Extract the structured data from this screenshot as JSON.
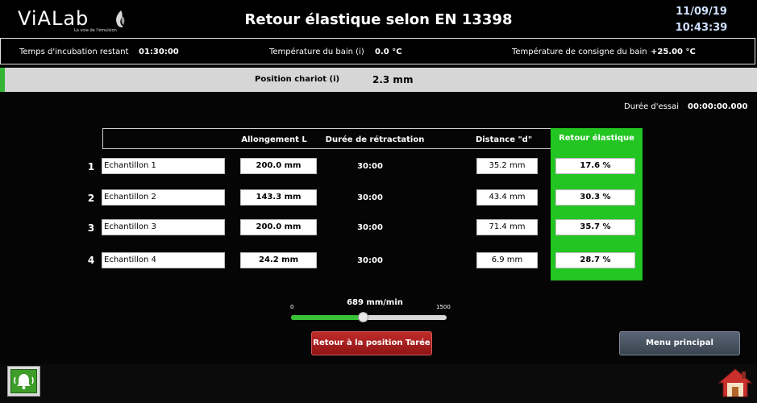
{
  "header": {
    "logo_text": "ViALab",
    "logo_tagline": "La voie de l'émulsion",
    "title": "Retour élastique selon EN 13398",
    "date": "11/09/19",
    "time": "10:43:39"
  },
  "info": {
    "incubation_label": "Temps d'incubation restant",
    "incubation_value": "01:30:00",
    "bath_temp_label": "Température du bain (i)",
    "bath_temp_value": "0.0 °C",
    "setpoint_label": "Température de consigne du bain",
    "setpoint_value": "+25.00 °C"
  },
  "chariot": {
    "label": "Position chariot (i)",
    "value": "2.3 mm"
  },
  "test_duration": {
    "label": "Durée d'essai",
    "value": "00:00:00.000"
  },
  "table": {
    "headers": {
      "elongation": "Allongement L",
      "retraction": "Durée de rétractation",
      "distance": "Distance \"d\"",
      "elastic_return": "Retour élastique"
    },
    "rows": [
      {
        "num": "1",
        "name": "Echantillon 1",
        "elongation": "200.0 mm",
        "retraction": "30:00",
        "distance": "35.2 mm",
        "elastic_return": "17.6 %"
      },
      {
        "num": "2",
        "name": "Echantillon 2",
        "elongation": "143.3 mm",
        "retraction": "30:00",
        "distance": "43.4 mm",
        "elastic_return": "30.3 %"
      },
      {
        "num": "3",
        "name": "Echantillon 3",
        "elongation": "200.0 mm",
        "retraction": "30:00",
        "distance": "71.4 mm",
        "elastic_return": "35.7 %"
      },
      {
        "num": "4",
        "name": "Echantillon 4",
        "elongation": "24.2 mm",
        "retraction": "30:00",
        "distance": "6.9 mm",
        "elastic_return": "28.7 %"
      }
    ]
  },
  "speed_slider": {
    "value_label": "689 mm/min",
    "min": "0",
    "max": "1500",
    "value": 689
  },
  "buttons": {
    "tare": "Retour à la position Tarée",
    "main_menu": "Menu principal"
  },
  "icons": {
    "alarm": "alarm-bell-icon",
    "home": "home-icon"
  },
  "colors": {
    "accent_green": "#22c522",
    "tare_red": "#a11d1d",
    "menu_gray": "#4a5461"
  }
}
